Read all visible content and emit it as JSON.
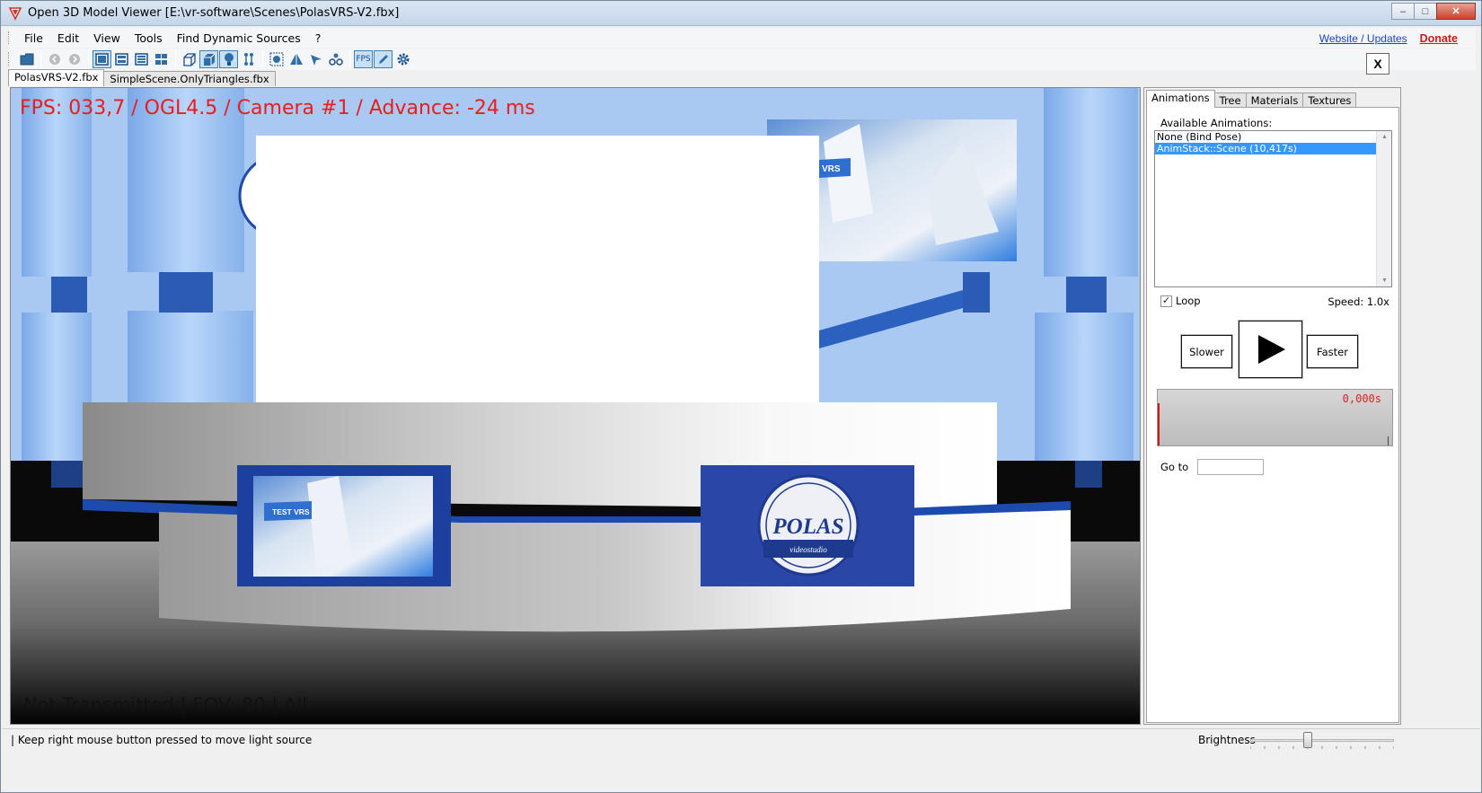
{
  "window": {
    "title": "Open 3D Model Viewer  [E:\\vr-software\\Scenes\\PolasVRS-V2.fbx]",
    "controls": {
      "minimize": "–",
      "maximize": "□",
      "close": "✕"
    }
  },
  "menu": {
    "items": [
      {
        "label": "File"
      },
      {
        "label": "Edit"
      },
      {
        "label": "View"
      },
      {
        "label": "Tools"
      },
      {
        "label": "Find Dynamic Sources"
      },
      {
        "label": "?"
      }
    ],
    "website_link": "Website / Updates",
    "donate_link": "Donate"
  },
  "toolbar": {
    "fps_label": "FPS",
    "close_view_label": "X"
  },
  "tabs": [
    {
      "label": "PolasVRS-V2.fbx",
      "active": true
    },
    {
      "label": "SimpleScene.OnlyTriangles.fbx",
      "active": false
    }
  ],
  "viewport": {
    "fps_overlay": "FPS: 033,7 / OGL4.5 / Camera #1 / Advance: -24 ms",
    "status_overlay": "Not Transmitted | FOV: 80 | All",
    "scene_texts": {
      "logo_main": "POLAS",
      "logo_sub": "videostudio",
      "screen_text": "TEST VRS",
      "screen_text_top": "VRS"
    }
  },
  "panel": {
    "tabs": [
      {
        "label": "Animations",
        "active": true
      },
      {
        "label": "Tree",
        "active": false
      },
      {
        "label": "Materials",
        "active": false
      },
      {
        "label": "Textures",
        "active": false
      }
    ],
    "available_label": "Available Animations:",
    "animations": [
      {
        "label": "None (Bind Pose)",
        "selected": false
      },
      {
        "label": "AnimStack::Scene (10,417s)",
        "selected": true
      }
    ],
    "loop_label": "Loop",
    "loop_checked": true,
    "speed_label": "Speed:  1.0x",
    "slower_label": "Slower",
    "faster_label": "Faster",
    "time_display": "0,000s",
    "goto_label": "Go to",
    "goto_value": ""
  },
  "statusbar": {
    "text": "| Keep right mouse button pressed to move light source",
    "brightness_label": "Brightness",
    "brightness_level": 0.4
  }
}
